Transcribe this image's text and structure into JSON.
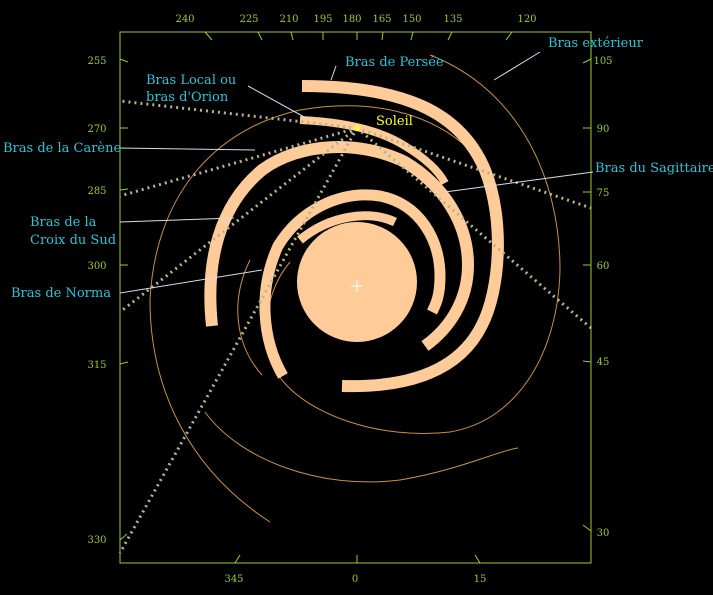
{
  "colors": {
    "background": "#000000",
    "frame": "#9acd32",
    "degree_text": "#9acd32",
    "arm_fill": "#ffcc99",
    "thin_arm": "#c8904a",
    "label_text": "#2ec4d6",
    "leader_line": "#cfe0ee",
    "sun_text": "#ffff33",
    "sightline": "#b5b58c"
  },
  "degrees": {
    "top": [
      "240",
      "225",
      "210",
      "195",
      "180",
      "165",
      "150",
      "135",
      "120"
    ],
    "left": [
      "255",
      "270",
      "285",
      "300",
      "315",
      "330"
    ],
    "right": [
      "105",
      "90",
      "75",
      "60",
      "45",
      "30"
    ],
    "bottom": [
      "345",
      "0",
      "15"
    ]
  },
  "labels": {
    "perseus": "Bras de Persée",
    "outer": "Bras extérieur",
    "local_line1": "Bras Local ou",
    "local_line2": "bras d'Orion",
    "sun": "Soleil",
    "carina": "Bras de la Carène",
    "sagittarius": "Bras du Sagittaire",
    "crux_line1": "Bras de la",
    "crux_line2": "Croix du Sud",
    "norma": "Bras de Norma"
  },
  "icons": {
    "galactic_center": "crosshair-icon"
  }
}
